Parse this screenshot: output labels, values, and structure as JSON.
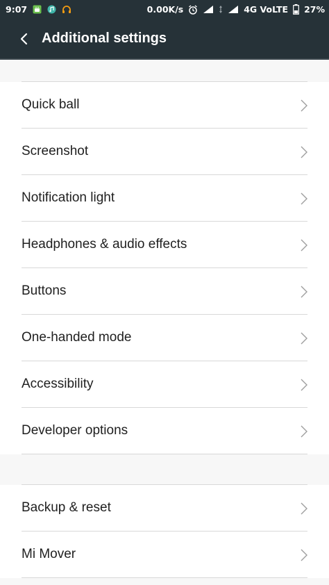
{
  "status_bar": {
    "time": "9:07",
    "network_speed": "0.00K/s",
    "network_type": "4G VoLTE",
    "battery": "27%",
    "icons": [
      "android-notification-icon",
      "music-app-icon",
      "headphones-icon",
      "alarm-icon",
      "signal-icon",
      "data-transfer-icon",
      "signal-icon-2",
      "battery-icon"
    ]
  },
  "header": {
    "title": "Additional settings",
    "back_icon": "chevron-left-icon"
  },
  "settings": {
    "group1": [
      {
        "label": "Quick ball"
      },
      {
        "label": "Screenshot"
      },
      {
        "label": "Notification light"
      },
      {
        "label": "Headphones & audio effects"
      },
      {
        "label": "Buttons"
      },
      {
        "label": "One-handed mode"
      },
      {
        "label": "Accessibility"
      },
      {
        "label": "Developer options"
      }
    ],
    "group2": [
      {
        "label": "Backup & reset"
      },
      {
        "label": "Mi Mover"
      }
    ]
  },
  "colors": {
    "app_bar": "#263238",
    "background": "#f7f7f7",
    "row_background": "#ffffff",
    "divider": "#d8d8d8"
  }
}
